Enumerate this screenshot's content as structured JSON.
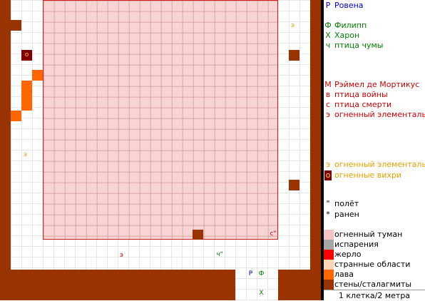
{
  "map": {
    "labels": {
      "fire_elemental_top_right": "э",
      "vortex_left": "о",
      "fire_elemental_left": "э",
      "fire_elemental_bottom": "э",
      "fog_corner": "с\"",
      "plague_bird": "ч\"",
      "rovena": "Р",
      "philipp": "Ф",
      "kharon": "Х"
    }
  },
  "legend": {
    "entries": [
      {
        "symbol": "Р",
        "text": "Ровена",
        "color": "#0000cc"
      },
      {
        "symbol": "Ф",
        "text": "Филипп",
        "color": "#008000"
      },
      {
        "symbol": "Х",
        "text": "Харон",
        "color": "#008000"
      },
      {
        "symbol": "ч",
        "text": "птица чумы",
        "color": "#008000"
      },
      {
        "symbol": "М",
        "text": "Рэймел де Мортикус",
        "color": "#cc0000"
      },
      {
        "symbol": "в",
        "text": "птица войны",
        "color": "#cc0000"
      },
      {
        "symbol": "с",
        "text": "птица смерти",
        "color": "#cc0000"
      },
      {
        "symbol": "э",
        "text": "огненный элементаль",
        "color": "#cc0000"
      },
      {
        "symbol": "э",
        "text": "огненный элементаль",
        "color": "#e6a000"
      },
      {
        "symbol": "о",
        "text": "огненные вихри",
        "color": "#e6a000"
      },
      {
        "symbol": "\"",
        "text": "полёт",
        "color": "#000000"
      },
      {
        "symbol": "*",
        "text": "ранен",
        "color": "#000000"
      }
    ],
    "terrain": [
      {
        "text": "огненный туман",
        "color": "#f4c2c2"
      },
      {
        "text": "испарения",
        "color": "#a6a6a6"
      },
      {
        "text": "жерло",
        "color": "#ff0000"
      },
      {
        "text": "странные области",
        "color": "#fcd5b4"
      },
      {
        "text": "лава",
        "color": "#ff6600"
      },
      {
        "text": "стены/сталагмиты",
        "color": "#993300"
      }
    ],
    "scale": "1 клетка/2 метра"
  }
}
